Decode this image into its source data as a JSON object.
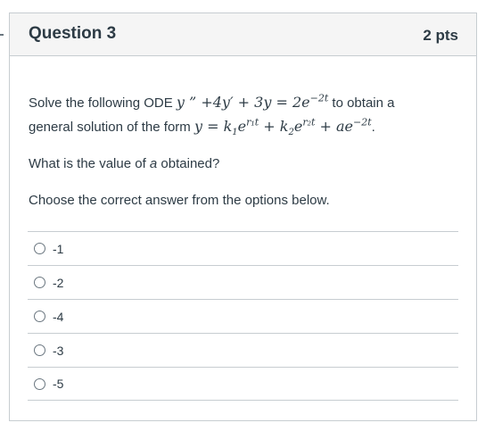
{
  "question": {
    "title": "Question 3",
    "points": "2 pts",
    "text_before_eq1": "Solve the following ODE ",
    "text_after_eq1": " to obtain a",
    "text_before_eq2": "general solution of the form ",
    "text_after_eq2": ".",
    "prompt_prefix": "What is the value of ",
    "prompt_var": "a",
    "prompt_suffix": " obtained?",
    "instruction": "Choose the correct answer from the options below."
  },
  "equations": {
    "ode_y": "y",
    "ode_dq": " ” ",
    "ode_rest": "+4y′ + 3y = 2e",
    "ode_exp": "−2t",
    "sol_y": "y = k",
    "sol_k1_sub": "1",
    "sol_e1": "e",
    "sol_exp1": "r₁t",
    "sol_plus_k2": " + k",
    "sol_k2_sub": "2",
    "sol_e2": "e",
    "sol_exp2": "r₂t",
    "sol_plus_ae": " + ae",
    "sol_exp3": "−2t"
  },
  "answers": [
    {
      "label": "-1"
    },
    {
      "label": "-2"
    },
    {
      "label": "-4"
    },
    {
      "label": "-3"
    },
    {
      "label": "-5"
    }
  ]
}
